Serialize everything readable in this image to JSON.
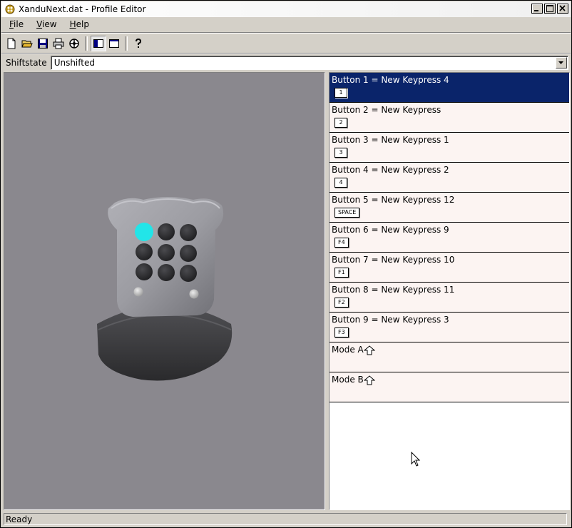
{
  "window": {
    "title": "XanduNext.dat - Profile Editor"
  },
  "menu": [
    {
      "hotkey": "F",
      "rest": "ile"
    },
    {
      "hotkey": "V",
      "rest": "iew"
    },
    {
      "hotkey": "H",
      "rest": "elp"
    }
  ],
  "toolbar": {
    "icons": [
      "new-file-icon",
      "open-folder-icon",
      "save-icon",
      "print-icon",
      "target-icon",
      "split-view-icon",
      "single-view-icon",
      "help-icon"
    ]
  },
  "shiftstate": {
    "label": "Shiftstate",
    "value": "Unshifted"
  },
  "buttons": [
    {
      "title": "Button 1 = New Keypress 4",
      "key": "1"
    },
    {
      "title": "Button 2 = New Keypress",
      "key": "2"
    },
    {
      "title": "Button 3 = New Keypress 1",
      "key": "3"
    },
    {
      "title": "Button 4 = New Keypress 2",
      "key": "4"
    },
    {
      "title": "Button 5 = New Keypress 12",
      "key": "SPACE"
    },
    {
      "title": "Button 6 = New Keypress 9",
      "key": "F4"
    },
    {
      "title": "Button 7 = New Keypress 10",
      "key": "F1"
    },
    {
      "title": "Button 8 = New Keypress 11",
      "key": "F2"
    },
    {
      "title": "Button 9 = New Keypress 3",
      "key": "F3"
    }
  ],
  "modes": [
    {
      "title": "Mode A"
    },
    {
      "title": "Mode B"
    }
  ],
  "status": {
    "text": "Ready"
  },
  "colors": {
    "selection": "#0a246a",
    "row_bg": "#fcf4f2",
    "viewport_bg": "#8a888e",
    "active_button": "#22e5e8"
  }
}
